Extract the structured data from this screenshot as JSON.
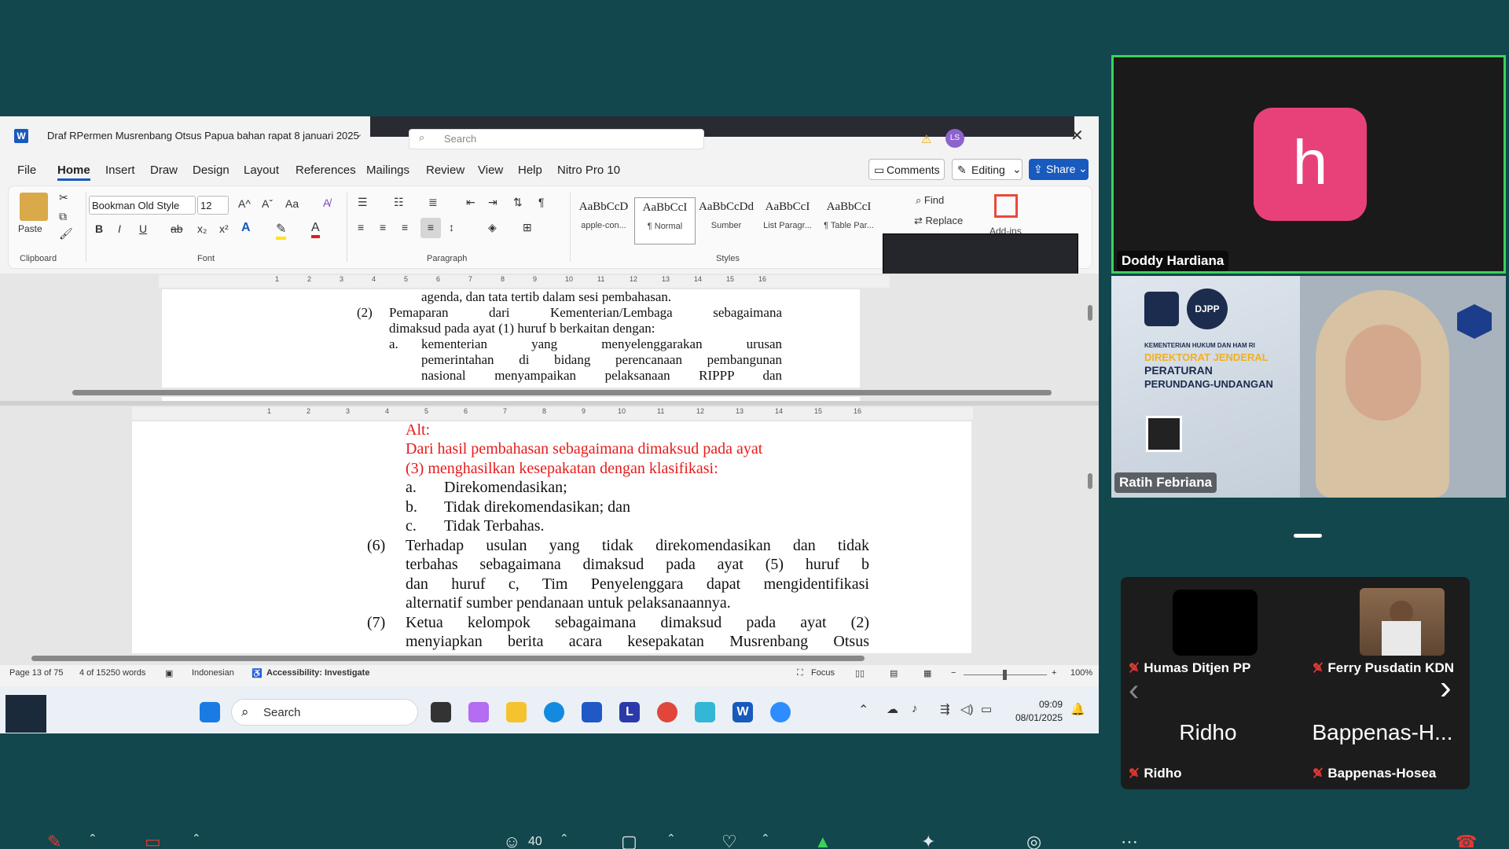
{
  "word": {
    "app_icon": "W",
    "doc_title": "Draf RPermen Musrenbang Otsus Papua bahan rapat 8 januari 2025",
    "search_placeholder": "Search",
    "user_initials": "LS",
    "tabs": [
      "File",
      "Home",
      "Insert",
      "Draw",
      "Design",
      "Layout",
      "References",
      "Mailings",
      "Review",
      "View",
      "Help",
      "Nitro Pro 10"
    ],
    "comments_label": "Comments",
    "editing_label": "Editing",
    "share_label": "Share",
    "clipboard": {
      "paste": "Paste",
      "group": "Clipboard"
    },
    "font": {
      "name": "Bookman Old Style",
      "size": "12",
      "group": "Font",
      "grow": "A^",
      "shrink": "Aˇ",
      "case": "Aa",
      "bold": "B",
      "italic": "I",
      "underline": "U",
      "strike": "ab",
      "sub": "x₂",
      "sup": "x²"
    },
    "paragraph_group": "Paragraph",
    "styles_group": "Styles",
    "styles": [
      {
        "sample": "AaBbCcD",
        "name": "apple-con..."
      },
      {
        "sample": "AaBbCcI",
        "name": "¶ Normal"
      },
      {
        "sample": "AaBbCcDd",
        "name": "Sumber"
      },
      {
        "sample": "AaBbCcI",
        "name": "List Paragr..."
      },
      {
        "sample": "AaBbCcI",
        "name": "¶ Table Par..."
      }
    ],
    "find_label": "Find",
    "replace_label": "Replace",
    "addins_label": "Add-ins",
    "ruler_numbers": [
      "1",
      "2",
      "3",
      "4",
      "5",
      "6",
      "7",
      "8",
      "9",
      "10",
      "11",
      "12",
      "13",
      "14",
      "15",
      "16"
    ],
    "top_lines": [
      "agenda, dan tata tertib dalam sesi pembahasan.",
      "Pemaparan dari Kementerian/Lembaga sebagaimana",
      "dimaksud pada ayat (1) huruf b berkaitan dengan:",
      "kementerian yang menyelenggarakan urusan",
      "pemerintahan di bidang perencanaan pembangunan",
      "nasional menyampaikan pelaksanaan RIPPP dan"
    ],
    "top_markers": [
      "(2)",
      "a."
    ],
    "bottom_red": [
      "Alt:",
      "Dari hasil pembahasan sebagaimana dimaksud pada ayat",
      "(3) menghasilkan kesepakatan dengan klasifikasi:"
    ],
    "bottom_list": [
      {
        "m": "a.",
        "t": "Direkomendasikan;"
      },
      {
        "m": "b.",
        "t": "Tidak direkomendasikan; dan"
      },
      {
        "m": "c.",
        "t": "Tidak Terbahas."
      }
    ],
    "bottom_lines": [
      "Terhadap usulan yang tidak direkomendasikan dan tidak",
      "terbahas sebagaimana dimaksud pada ayat (5) huruf b",
      "dan huruf c, Tim Penyelenggara dapat mengidentifikasi",
      "alternatif sumber pendanaan untuk pelaksanaannya.",
      "Ketua kelompok sebagaimana dimaksud pada ayat (2)",
      "menyiapkan berita acara kesepakatan Musrenbang Otsus"
    ],
    "bottom_markers": [
      "(6)",
      "(7)"
    ],
    "status": {
      "page": "Page 13 of 75",
      "words": "4 of 15250 words",
      "lang": "Indonesian",
      "access": "Accessibility: Investigate",
      "focus": "Focus",
      "zoom": "100%"
    }
  },
  "taskbar": {
    "search": "Search",
    "time": "09:09",
    "date": "08/01/2025"
  },
  "participants": {
    "main": {
      "avatar_letter": "h",
      "name": "Doddy Hardiana",
      "avatar_color": "#e8417a"
    },
    "video": {
      "name": "Ratih Febriana",
      "poster_line1": "KEMENTERIAN HUKUM DAN HAM RI",
      "poster_line2": "DIREKTORAT JENDERAL",
      "poster_line3": "PERATURAN",
      "poster_line4": "PERUNDANG-UNDANGAN",
      "poster_badge": "DJPP"
    },
    "small": [
      {
        "name": "Humas Ditjen PP"
      },
      {
        "name": "Ferry Pusdatin KDN"
      },
      {
        "center": "Ridho",
        "name": "Ridho"
      },
      {
        "center": "Bappenas-H...",
        "name": "Bappenas-Hosea"
      }
    ],
    "meeting_count": "40"
  }
}
